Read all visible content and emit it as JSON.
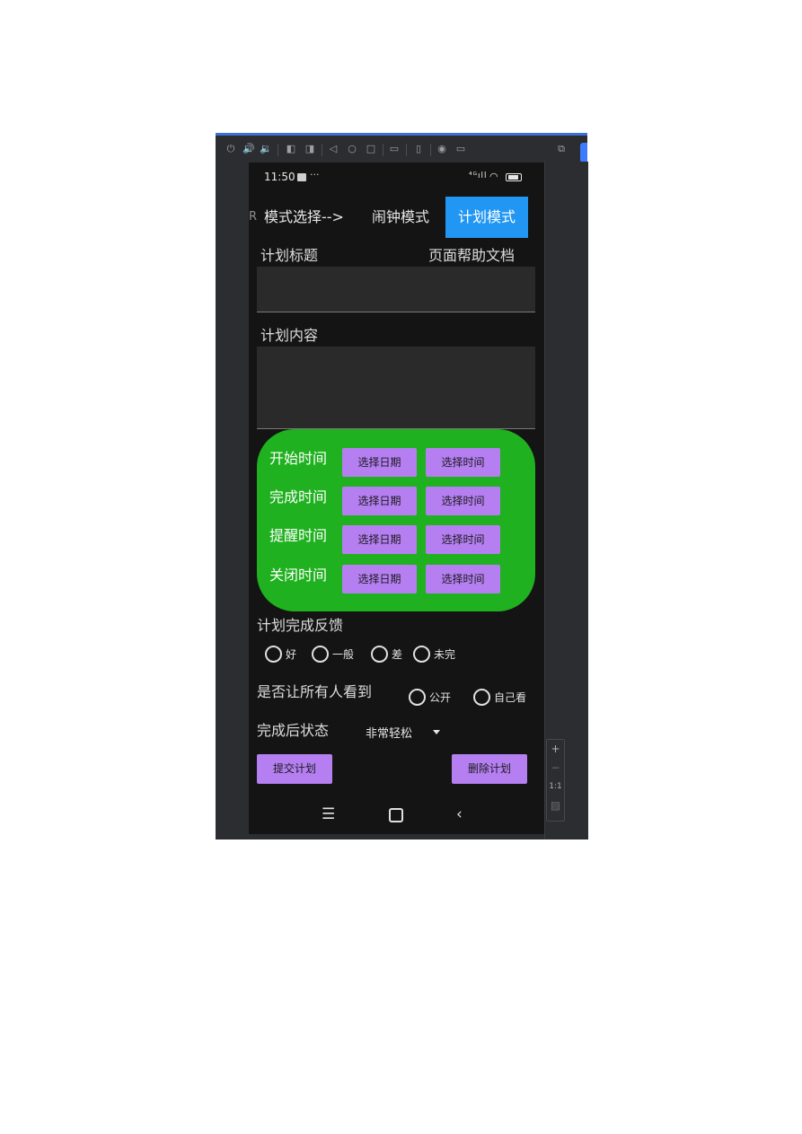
{
  "status_bar": {
    "time": "11:50",
    "dots": "···",
    "signal": "⁴ᴳıll"
  },
  "tabs": {
    "clipped": "R",
    "mode_select": "模式选择-->",
    "alarm": "闹钟模式",
    "plan": "计划模式"
  },
  "form": {
    "title_label": "计划标题",
    "help_link": "页面帮助文档",
    "content_label": "计划内容",
    "title_value": "",
    "content_value": ""
  },
  "time_rows": [
    {
      "label": "开始时间",
      "date_btn": "选择日期",
      "time_btn": "选择时间"
    },
    {
      "label": "完成时间",
      "date_btn": "选择日期",
      "time_btn": "选择时间"
    },
    {
      "label": "提醒时间",
      "date_btn": "选择日期",
      "time_btn": "选择时间"
    },
    {
      "label": "关闭时间",
      "date_btn": "选择日期",
      "time_btn": "选择时间"
    }
  ],
  "feedback": {
    "label": "计划完成反馈",
    "options": [
      "好",
      "一般",
      "差",
      "未完"
    ]
  },
  "visibility": {
    "label": "是否让所有人看到",
    "options": [
      "公开",
      "自己看"
    ]
  },
  "after_state": {
    "label": "完成后状态",
    "selected": "非常轻松"
  },
  "actions": {
    "submit": "提交计划",
    "delete": "删除计划"
  },
  "zoom": {
    "plus": "+",
    "minus": "−",
    "one_to_one": "1:1"
  },
  "colors": {
    "tab_selected": "#2196f3",
    "time_panel": "#1fb11f",
    "button": "#b57ff2",
    "background": "#141414"
  }
}
